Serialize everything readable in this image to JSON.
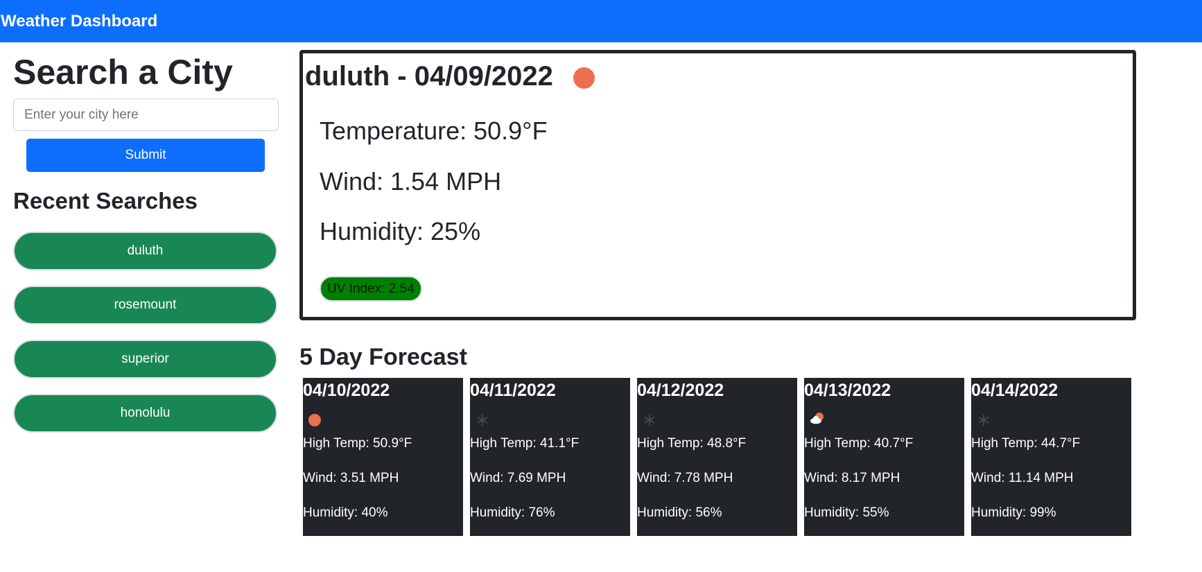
{
  "navbar": {
    "title": "Weather Dashboard"
  },
  "search": {
    "heading": "Search a City",
    "placeholder": "Enter your city here",
    "submit_label": "Submit"
  },
  "recent": {
    "heading": "Recent Searches",
    "items": [
      {
        "label": "duluth"
      },
      {
        "label": "rosemount"
      },
      {
        "label": "superior"
      },
      {
        "label": "honolulu"
      }
    ]
  },
  "current": {
    "title": "duluth - 04/09/2022",
    "icon": "clear-sun-icon",
    "temperature": "Temperature: 50.9°F",
    "wind": "Wind: 1.54 MPH",
    "humidity": "Humidity: 25%",
    "uv": "UV Index: 2.54",
    "uv_color": "#008000"
  },
  "forecast": {
    "heading": "5 Day Forecast",
    "days": [
      {
        "date": "04/10/2022",
        "icon": "clear-sun-icon",
        "temp": "High Temp: 50.9°F",
        "wind": "Wind: 3.51 MPH",
        "humidity": "Humidity: 40%"
      },
      {
        "date": "04/11/2022",
        "icon": "snow-icon",
        "temp": "High Temp: 41.1°F",
        "wind": "Wind: 7.69 MPH",
        "humidity": "Humidity: 76%"
      },
      {
        "date": "04/12/2022",
        "icon": "snow-icon",
        "temp": "High Temp: 48.8°F",
        "wind": "Wind: 7.78 MPH",
        "humidity": "Humidity: 56%"
      },
      {
        "date": "04/13/2022",
        "icon": "partly-cloudy-icon",
        "temp": "High Temp: 40.7°F",
        "wind": "Wind: 8.17 MPH",
        "humidity": "Humidity: 55%"
      },
      {
        "date": "04/14/2022",
        "icon": "snow-icon",
        "temp": "High Temp: 44.7°F",
        "wind": "Wind: 11.14 MPH",
        "humidity": "Humidity: 99%"
      }
    ]
  },
  "colors": {
    "primary": "#0d6efd",
    "success": "#198754",
    "dark": "#212529",
    "sun": "#ee6e4e"
  }
}
